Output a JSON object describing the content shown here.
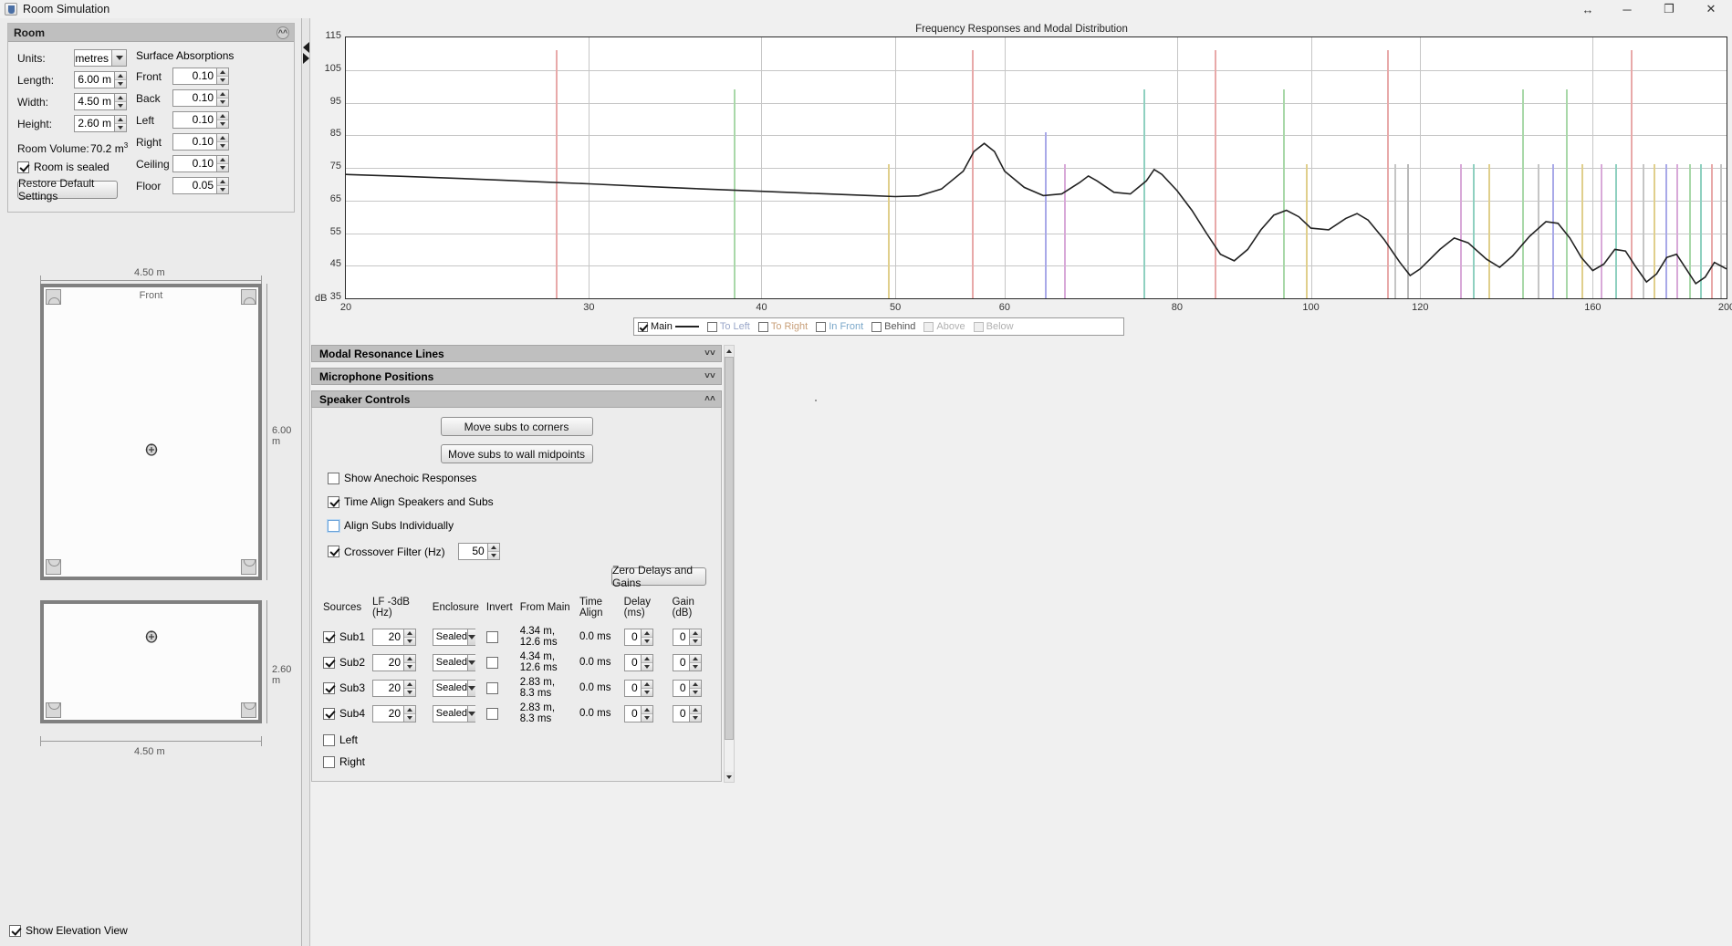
{
  "window": {
    "title": "Room Simulation",
    "icon": "java-app-icon",
    "buttons": {
      "resize": "↔",
      "minimize": "─",
      "maximize": "❐",
      "close": "✕"
    }
  },
  "room_panel": {
    "header": "Room",
    "collapse_icon": "chevron-up-icon",
    "units_label": "Units:",
    "units_value": "metres",
    "length_label": "Length:",
    "length_value": "6.00 m",
    "width_label": "Width:",
    "width_value": "4.50 m",
    "height_label": "Height:",
    "height_value": "2.60 m",
    "volume_label": "Room Volume:",
    "volume_value": "70.2 m",
    "volume_exp": "3",
    "sealed_label": "Room is sealed",
    "sealed_checked": true,
    "restore_button": "Restore Default Settings",
    "absorptions_title": "Surface Absorptions",
    "absorptions": [
      {
        "label": "Front",
        "value": "0.10"
      },
      {
        "label": "Back",
        "value": "0.10"
      },
      {
        "label": "Left",
        "value": "0.10"
      },
      {
        "label": "Right",
        "value": "0.10"
      },
      {
        "label": "Ceiling",
        "value": "0.10"
      },
      {
        "label": "Floor",
        "value": "0.05"
      }
    ]
  },
  "room_views": {
    "plan_width_label": "4.50 m",
    "plan_depth_label": "6.00 m",
    "front_label": "Front",
    "elev_width_label": "4.50 m",
    "elev_height_label": "2.60 m",
    "show_elevation_label": "Show Elevation View",
    "show_elevation_checked": true
  },
  "chart_data": {
    "type": "line",
    "title": "Frequency Responses and Modal Distribution",
    "xlabel": "",
    "ylabel": "dB",
    "xscale": "log",
    "xlim": [
      20,
      200
    ],
    "ylim": [
      35,
      115
    ],
    "yticks": [
      115,
      105,
      95,
      85,
      75,
      65,
      55,
      45,
      35
    ],
    "xticks": [
      20,
      30,
      40,
      50,
      60,
      80,
      100,
      120,
      160,
      200
    ],
    "y_unit_label": "dB",
    "grid": true,
    "series": [
      {
        "name": "Main",
        "color": "#222222",
        "points": [
          [
            20,
            73.0
          ],
          [
            22,
            72.4
          ],
          [
            24,
            71.8
          ],
          [
            26,
            71.2
          ],
          [
            28,
            70.6
          ],
          [
            30,
            70.1
          ],
          [
            33,
            69.3
          ],
          [
            36,
            68.6
          ],
          [
            40,
            67.8
          ],
          [
            44,
            67.1
          ],
          [
            48,
            66.5
          ],
          [
            50,
            66.2
          ],
          [
            52,
            66.4
          ],
          [
            54,
            68.5
          ],
          [
            56,
            74.0
          ],
          [
            57,
            80.0
          ],
          [
            58,
            82.5
          ],
          [
            59,
            80.0
          ],
          [
            60,
            74.0
          ],
          [
            62,
            69.0
          ],
          [
            64,
            66.5
          ],
          [
            66,
            67.0
          ],
          [
            68,
            70.5
          ],
          [
            69,
            72.5
          ],
          [
            70,
            71.0
          ],
          [
            72,
            67.5
          ],
          [
            74,
            67.0
          ],
          [
            76,
            71.0
          ],
          [
            77,
            74.5
          ],
          [
            78,
            73.0
          ],
          [
            80,
            68.0
          ],
          [
            82,
            62.0
          ],
          [
            84,
            55.0
          ],
          [
            86,
            48.5
          ],
          [
            88,
            46.5
          ],
          [
            90,
            50.0
          ],
          [
            92,
            56.0
          ],
          [
            94,
            60.5
          ],
          [
            96,
            62.0
          ],
          [
            98,
            60.0
          ],
          [
            100,
            56.5
          ],
          [
            103,
            56.0
          ],
          [
            106,
            59.5
          ],
          [
            108,
            61.0
          ],
          [
            110,
            59.0
          ],
          [
            113,
            53.0
          ],
          [
            116,
            46.0
          ],
          [
            118,
            42.0
          ],
          [
            120,
            44.0
          ],
          [
            124,
            50.0
          ],
          [
            127,
            53.5
          ],
          [
            130,
            52.0
          ],
          [
            134,
            47.0
          ],
          [
            137,
            44.5
          ],
          [
            140,
            48.0
          ],
          [
            144,
            54.0
          ],
          [
            148,
            58.5
          ],
          [
            151,
            58.0
          ],
          [
            154,
            53.5
          ],
          [
            157,
            47.5
          ],
          [
            160,
            43.5
          ],
          [
            163,
            45.5
          ],
          [
            166,
            50.0
          ],
          [
            169,
            49.5
          ],
          [
            172,
            44.5
          ],
          [
            175,
            40.0
          ],
          [
            178,
            42.5
          ],
          [
            181,
            47.5
          ],
          [
            184,
            48.5
          ],
          [
            187,
            44.0
          ],
          [
            190,
            39.5
          ],
          [
            193,
            41.5
          ],
          [
            196,
            46.0
          ],
          [
            200,
            44.0
          ]
        ]
      }
    ],
    "modal_lines": [
      {
        "freq": 28.4,
        "level": 111,
        "color": "#e8a9a9"
      },
      {
        "freq": 38.2,
        "level": 99,
        "color": "#a9d8a9"
      },
      {
        "freq": 49.4,
        "level": 76,
        "color": "#e0cf8c"
      },
      {
        "freq": 56.8,
        "level": 111,
        "color": "#e8a9a9"
      },
      {
        "freq": 64.2,
        "level": 86,
        "color": "#a9a9e8"
      },
      {
        "freq": 66.3,
        "level": 76,
        "color": "#d8a9d8"
      },
      {
        "freq": 75.6,
        "level": 99,
        "color": "#8fd0c0"
      },
      {
        "freq": 85.2,
        "level": 111,
        "color": "#e8a9a9"
      },
      {
        "freq": 95.5,
        "level": 99,
        "color": "#a9d8a9"
      },
      {
        "freq": 99.1,
        "level": 76,
        "color": "#e0cf8c"
      },
      {
        "freq": 113.6,
        "level": 111,
        "color": "#e8a9a9"
      },
      {
        "freq": 115.0,
        "level": 76,
        "color": "#c5c5c5"
      },
      {
        "freq": 117.4,
        "level": 76,
        "color": "#b9b9b9"
      },
      {
        "freq": 128.3,
        "level": 76,
        "color": "#d8a9d8"
      },
      {
        "freq": 131.0,
        "level": 76,
        "color": "#8fd0c0"
      },
      {
        "freq": 134.5,
        "level": 76,
        "color": "#e0cf8c"
      },
      {
        "freq": 142.2,
        "level": 99,
        "color": "#a9d8a9"
      },
      {
        "freq": 146.0,
        "level": 76,
        "color": "#c5c5c5"
      },
      {
        "freq": 149.5,
        "level": 76,
        "color": "#a9a9e8"
      },
      {
        "freq": 153.0,
        "level": 99,
        "color": "#a9d8a9"
      },
      {
        "freq": 157.0,
        "level": 76,
        "color": "#e0cf8c"
      },
      {
        "freq": 162.0,
        "level": 76,
        "color": "#d8a9d8"
      },
      {
        "freq": 166.0,
        "level": 76,
        "color": "#8fd0c0"
      },
      {
        "freq": 170.4,
        "level": 111,
        "color": "#e8a9a9"
      },
      {
        "freq": 174.0,
        "level": 76,
        "color": "#c5c5c5"
      },
      {
        "freq": 177.0,
        "level": 76,
        "color": "#e0cf8c"
      },
      {
        "freq": 180.5,
        "level": 76,
        "color": "#a9a9e8"
      },
      {
        "freq": 184.0,
        "level": 76,
        "color": "#d8a9d8"
      },
      {
        "freq": 188.0,
        "level": 76,
        "color": "#a9d8a9"
      },
      {
        "freq": 191.5,
        "level": 76,
        "color": "#8fd0c0"
      },
      {
        "freq": 195.0,
        "level": 76,
        "color": "#e8a9a9"
      },
      {
        "freq": 198.0,
        "level": 76,
        "color": "#c5c5c5"
      }
    ],
    "legend": {
      "position": "bottom",
      "entries": [
        {
          "label": "Main",
          "checked": true,
          "color": "#222222",
          "enabled": true
        },
        {
          "label": "To Left",
          "checked": false,
          "color": "#9aa7c9",
          "enabled": true
        },
        {
          "label": "To Right",
          "checked": false,
          "color": "#c9a07a",
          "enabled": true
        },
        {
          "label": "In Front",
          "checked": false,
          "color": "#7aa7c9",
          "enabled": true
        },
        {
          "label": "Behind",
          "checked": false,
          "color": "#555555",
          "enabled": true
        },
        {
          "label": "Above",
          "checked": false,
          "color": "#c9a0c9",
          "enabled": false
        },
        {
          "label": "Below",
          "checked": false,
          "color": "#9a9a9a",
          "enabled": false
        }
      ]
    }
  },
  "accordions": [
    {
      "title": "Modal Resonance Lines",
      "expanded": false,
      "icon": "chevron-down-icon"
    },
    {
      "title": "Microphone Positions",
      "expanded": false,
      "icon": "chevron-down-icon"
    },
    {
      "title": "Speaker Controls",
      "expanded": true,
      "icon": "chevron-up-icon"
    }
  ],
  "speaker_controls": {
    "move_corners_button": "Move subs to corners",
    "move_midpoints_button": "Move subs to wall midpoints",
    "show_anechoic_label": "Show Anechoic Responses",
    "show_anechoic_checked": false,
    "time_align_label": "Time Align Speakers and Subs",
    "time_align_checked": true,
    "align_individually_label": "Align Subs Individually",
    "align_individually_checked": false,
    "crossover_label": "Crossover Filter (Hz)",
    "crossover_checked": true,
    "crossover_value": "50",
    "zero_button": "Zero Delays and Gains",
    "table": {
      "headers": [
        "Sources",
        "LF -3dB (Hz)",
        "Enclosure",
        "Invert",
        "From Main",
        "Time Align",
        "Delay (ms)",
        "Gain (dB)"
      ],
      "rows": [
        {
          "name": "Sub1",
          "enabled": true,
          "lf": "20",
          "enclosure": "Sealed",
          "invert": false,
          "from_main": "4.34 m, 12.6 ms",
          "time_align": "0.0 ms",
          "delay": "0",
          "gain": "0"
        },
        {
          "name": "Sub2",
          "enabled": true,
          "lf": "20",
          "enclosure": "Sealed",
          "invert": false,
          "from_main": "4.34 m, 12.6 ms",
          "time_align": "0.0 ms",
          "delay": "0",
          "gain": "0"
        },
        {
          "name": "Sub3",
          "enabled": true,
          "lf": "20",
          "enclosure": "Sealed",
          "invert": false,
          "from_main": "2.83 m, 8.3 ms",
          "time_align": "0.0 ms",
          "delay": "0",
          "gain": "0"
        },
        {
          "name": "Sub4",
          "enabled": true,
          "lf": "20",
          "enclosure": "Sealed",
          "invert": false,
          "from_main": "2.83 m, 8.3 ms",
          "time_align": "0.0 ms",
          "delay": "0",
          "gain": "0"
        }
      ],
      "extra_rows": [
        {
          "name": "Left",
          "enabled": false
        },
        {
          "name": "Right",
          "enabled": false
        }
      ]
    }
  }
}
